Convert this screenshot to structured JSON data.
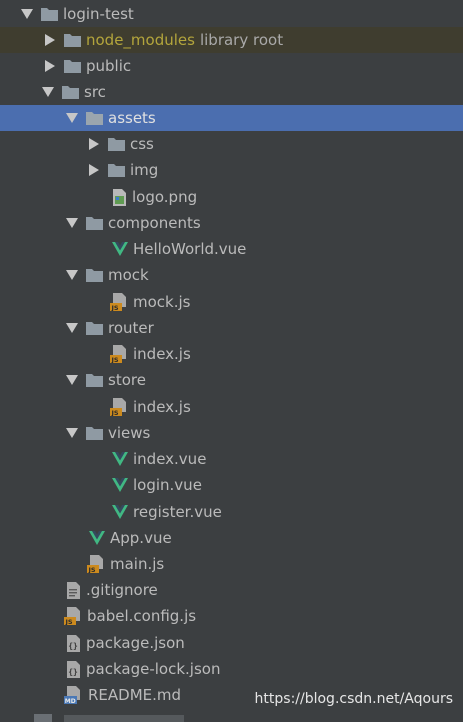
{
  "tree": {
    "root": {
      "label": "login-test",
      "icon": "folder-icon"
    },
    "node_modules": {
      "label": "node_modules",
      "hint": "library root",
      "icon": "folder-icon"
    },
    "public": {
      "label": "public",
      "icon": "folder-icon"
    },
    "src": {
      "label": "src",
      "icon": "folder-icon"
    },
    "assets": {
      "label": "assets",
      "icon": "folder-icon"
    },
    "css": {
      "label": "css",
      "icon": "folder-icon"
    },
    "img": {
      "label": "img",
      "icon": "folder-icon"
    },
    "logo": {
      "label": "logo.png",
      "icon": "image-file-icon"
    },
    "components": {
      "label": "components",
      "icon": "folder-icon"
    },
    "helloworld": {
      "label": "HelloWorld.vue",
      "icon": "vue-icon"
    },
    "mock": {
      "label": "mock",
      "icon": "folder-icon"
    },
    "mockjs": {
      "label": "mock.js",
      "icon": "js-file-icon"
    },
    "router": {
      "label": "router",
      "icon": "folder-icon"
    },
    "router_index": {
      "label": "index.js",
      "icon": "js-file-icon"
    },
    "store": {
      "label": "store",
      "icon": "folder-icon"
    },
    "store_index": {
      "label": "index.js",
      "icon": "js-file-icon"
    },
    "views": {
      "label": "views",
      "icon": "folder-icon"
    },
    "views_index": {
      "label": "index.vue",
      "icon": "vue-icon"
    },
    "views_login": {
      "label": "login.vue",
      "icon": "vue-icon"
    },
    "views_register": {
      "label": "register.vue",
      "icon": "vue-icon"
    },
    "app": {
      "label": "App.vue",
      "icon": "vue-icon"
    },
    "mainjs": {
      "label": "main.js",
      "icon": "js-file-icon"
    },
    "gitignore": {
      "label": ".gitignore",
      "icon": "text-file-icon"
    },
    "babel": {
      "label": "babel.config.js",
      "icon": "js-file-icon"
    },
    "package": {
      "label": "package.json",
      "icon": "json-file-icon"
    },
    "packagelock": {
      "label": "package-lock.json",
      "icon": "json-file-icon"
    },
    "readme": {
      "label": "README.md",
      "icon": "markdown-file-icon"
    }
  },
  "watermark": "https://blog.csdn.net/Aqours",
  "colors": {
    "background": "#3c3f41",
    "selected": "#4b6eaf",
    "excluded_text": "#b3a53c",
    "vue_green": "#41b883",
    "js_badge": "#cc8a1e"
  }
}
